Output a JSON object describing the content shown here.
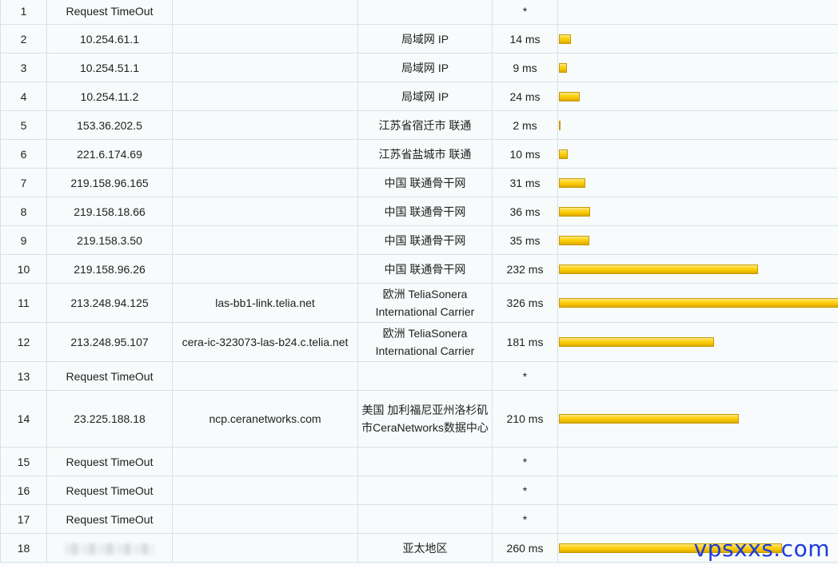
{
  "bar_scale_max_ms": 326,
  "bar_color": "#ffd51a",
  "hops": [
    {
      "hop": "1",
      "ip": "Request TimeOut",
      "host": "",
      "location": "",
      "latency": "*",
      "ms": null
    },
    {
      "hop": "2",
      "ip": "10.254.61.1",
      "host": "",
      "location": "局域网 IP",
      "latency": "14 ms",
      "ms": 14
    },
    {
      "hop": "3",
      "ip": "10.254.51.1",
      "host": "",
      "location": "局域网 IP",
      "latency": "9 ms",
      "ms": 9
    },
    {
      "hop": "4",
      "ip": "10.254.11.2",
      "host": "",
      "location": "局域网 IP",
      "latency": "24 ms",
      "ms": 24
    },
    {
      "hop": "5",
      "ip": "153.36.202.5",
      "host": "",
      "location": "江苏省宿迁市 联通",
      "latency": "2 ms",
      "ms": 2
    },
    {
      "hop": "6",
      "ip": "221.6.174.69",
      "host": "",
      "location": "江苏省盐城市 联通",
      "latency": "10 ms",
      "ms": 10
    },
    {
      "hop": "7",
      "ip": "219.158.96.165",
      "host": "",
      "location": "中国 联通骨干网",
      "latency": "31 ms",
      "ms": 31
    },
    {
      "hop": "8",
      "ip": "219.158.18.66",
      "host": "",
      "location": "中国 联通骨干网",
      "latency": "36 ms",
      "ms": 36
    },
    {
      "hop": "9",
      "ip": "219.158.3.50",
      "host": "",
      "location": "中国 联通骨干网",
      "latency": "35 ms",
      "ms": 35
    },
    {
      "hop": "10",
      "ip": "219.158.96.26",
      "host": "",
      "location": "中国 联通骨干网",
      "latency": "232 ms",
      "ms": 232
    },
    {
      "hop": "11",
      "ip": "213.248.94.125",
      "host": "las-bb1-link.telia.net",
      "location": "欧洲 TeliaSonera International Carrier",
      "latency": "326 ms",
      "ms": 326
    },
    {
      "hop": "12",
      "ip": "213.248.95.107",
      "host": "cera-ic-323073-las-b24.c.telia.net",
      "location": "欧洲 TeliaSonera International Carrier",
      "latency": "181 ms",
      "ms": 181
    },
    {
      "hop": "13",
      "ip": "Request TimeOut",
      "host": "",
      "location": "",
      "latency": "*",
      "ms": null
    },
    {
      "hop": "14",
      "ip": "23.225.188.18",
      "host": "ncp.ceranetworks.com",
      "location": "美国 加利福尼亚州洛杉矶市CeraNetworks数据中心",
      "latency": "210 ms",
      "ms": 210
    },
    {
      "hop": "15",
      "ip": "Request TimeOut",
      "host": "",
      "location": "",
      "latency": "*",
      "ms": null
    },
    {
      "hop": "16",
      "ip": "Request TimeOut",
      "host": "",
      "location": "",
      "latency": "*",
      "ms": null
    },
    {
      "hop": "17",
      "ip": "Request TimeOut",
      "host": "",
      "location": "",
      "latency": "*",
      "ms": null
    },
    {
      "hop": "18",
      "ip": "",
      "ip_blurred": true,
      "host": "",
      "location": "亚太地区",
      "latency": "260 ms",
      "ms": 260
    }
  ],
  "watermark": "vpsxxs.com"
}
